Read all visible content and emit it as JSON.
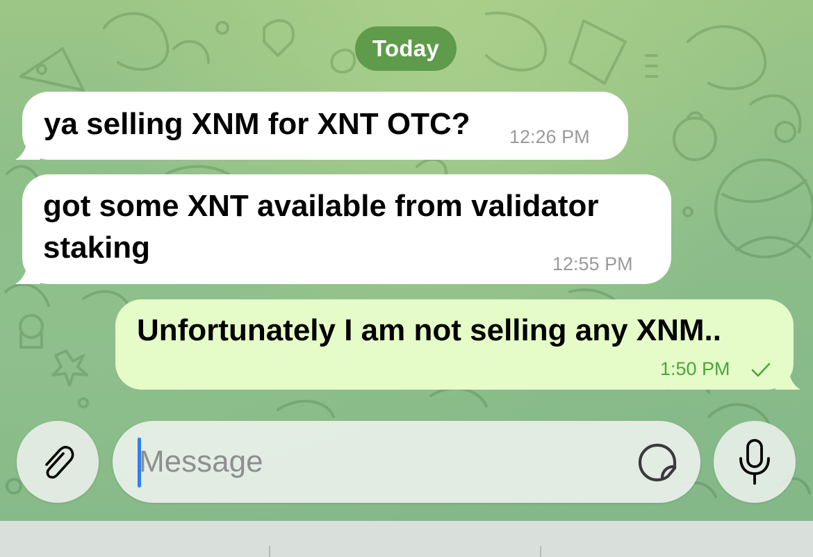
{
  "date_separator": "Today",
  "messages": [
    {
      "direction": "incoming",
      "text": "ya selling XNM for XNT OTC?",
      "time": "12:26 PM"
    },
    {
      "direction": "incoming",
      "text": "got some XNT available from validator staking",
      "time": "12:55 PM"
    },
    {
      "direction": "outgoing",
      "text": "Unfortunately I am not selling any XNM..",
      "time": "1:50 PM",
      "status_icon": "check-icon"
    }
  ],
  "composer": {
    "placeholder": "Message",
    "value": "",
    "attach_icon": "paperclip-icon",
    "sticker_icon": "sticker-icon",
    "mic_icon": "microphone-icon"
  },
  "colors": {
    "incoming_bubble": "#ffffff",
    "outgoing_bubble": "#e6fcc8",
    "date_pill": "#5e9b4b",
    "outgoing_time": "#4aa53c",
    "caret": "#2f7ff0"
  }
}
